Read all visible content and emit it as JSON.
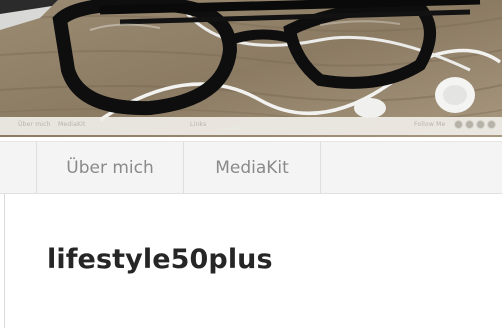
{
  "header": {
    "image_description_icon": "glasses-earphones-header-image",
    "strip": {
      "left_text_1": "Über mich",
      "left_text_2": "MediaKit",
      "mid_text": "Links",
      "right_text": "Follow Me",
      "social_icons": [
        "social-icon-1",
        "social-icon-2",
        "social-icon-3",
        "social-icon-4"
      ]
    }
  },
  "nav": {
    "items": [
      {
        "label": "Über mich"
      },
      {
        "label": "MediaKit"
      }
    ]
  },
  "site": {
    "title": "lifestyle50plus"
  },
  "colors": {
    "nav_bg": "#f4f4f4",
    "nav_text": "#8a8a8a",
    "title_text": "#262626"
  }
}
